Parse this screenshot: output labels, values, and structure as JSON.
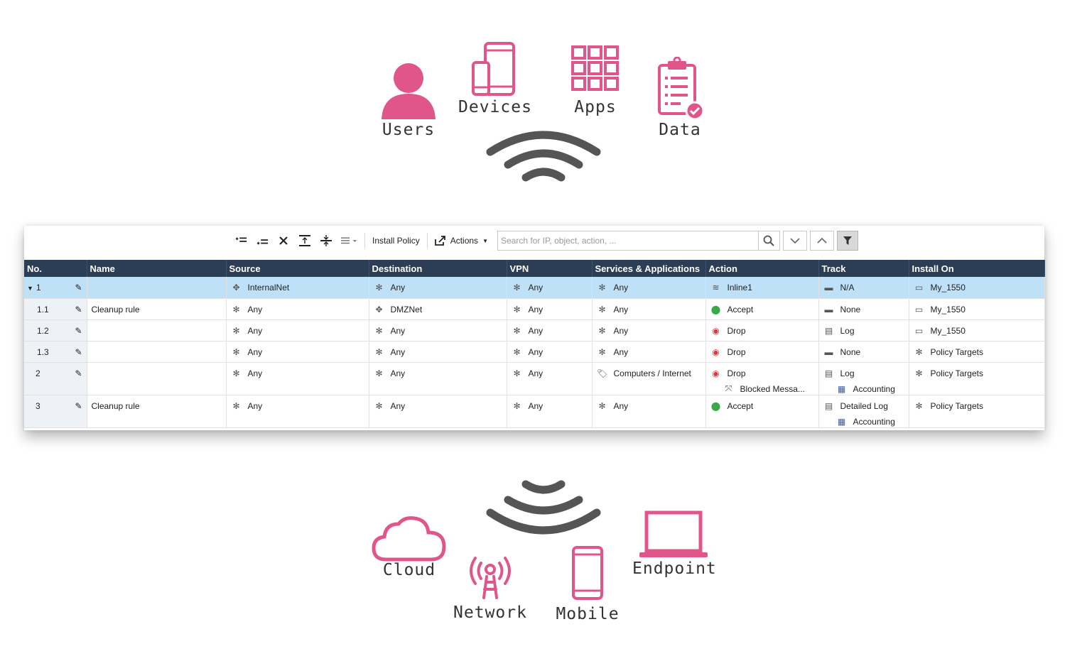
{
  "top_icons": {
    "users": "Users",
    "devices": "Devices",
    "apps": "Apps",
    "data": "Data"
  },
  "bottom_icons": {
    "cloud": "Cloud",
    "network": "Network",
    "mobile": "Mobile",
    "endpoint": "Endpoint"
  },
  "brand_color": "#e0568a",
  "toolbar": {
    "install_policy": "Install Policy",
    "actions": "Actions",
    "search_placeholder": "Search for IP, object, action, ..."
  },
  "columns": [
    "No.",
    "Name",
    "Source",
    "Destination",
    "VPN",
    "Services & Applications",
    "Action",
    "Track",
    "Install On"
  ],
  "rows": [
    {
      "no": "1",
      "name": "",
      "source": "InternalNet",
      "destination": "Any",
      "vpn": "Any",
      "services": "Any",
      "action": "Inline1",
      "track": [
        "N/A"
      ],
      "install_on": "My_1550"
    },
    {
      "no": "1.1",
      "name": "Cleanup rule",
      "source": "Any",
      "destination": "DMZNet",
      "vpn": "Any",
      "services": "Any",
      "action": "Accept",
      "track": [
        "None"
      ],
      "install_on": "My_1550"
    },
    {
      "no": "1.2",
      "name": "",
      "source": "Any",
      "destination": "Any",
      "vpn": "Any",
      "services": "Any",
      "action": "Drop",
      "track": [
        "Log"
      ],
      "install_on": "My_1550"
    },
    {
      "no": "1.3",
      "name": "",
      "source": "Any",
      "destination": "Any",
      "vpn": "Any",
      "services": "Any",
      "action": "Drop",
      "track": [
        "None"
      ],
      "install_on": "Policy Targets"
    },
    {
      "no": "2",
      "name": "",
      "source": "Any",
      "destination": "Any",
      "vpn": "Any",
      "services": "Computers / Internet",
      "action": "Drop",
      "action_extra": "Blocked Messa...",
      "track": [
        "Log",
        "Accounting"
      ],
      "install_on": "Policy Targets"
    },
    {
      "no": "3",
      "name": "Cleanup rule",
      "source": "Any",
      "destination": "Any",
      "vpn": "Any",
      "services": "Any",
      "action": "Accept",
      "track": [
        "Detailed Log",
        "Accounting"
      ],
      "install_on": "Policy Targets"
    }
  ]
}
